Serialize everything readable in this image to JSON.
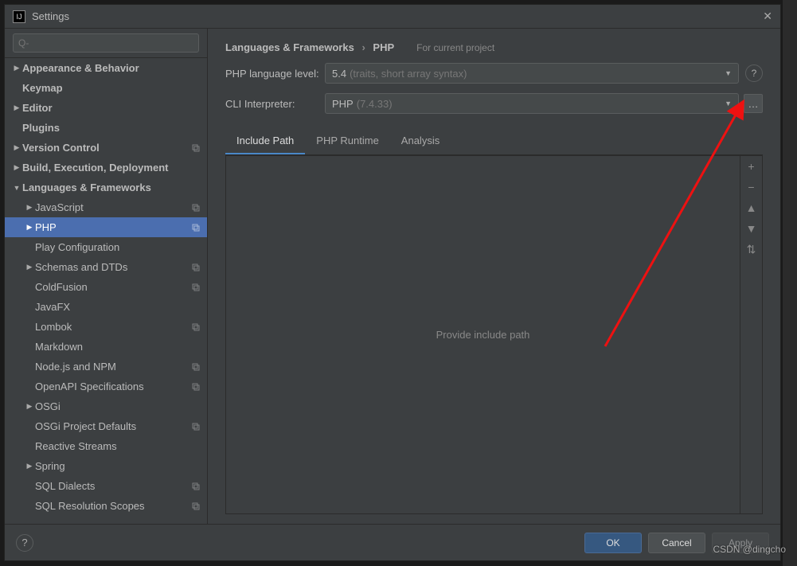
{
  "title": "Settings",
  "search_placeholder": "Q-",
  "breadcrumb": {
    "root": "Languages & Frameworks",
    "leaf": "PHP"
  },
  "header_hint": "For current project",
  "form": {
    "language_level_label": "PHP language level:",
    "language_level_value": "5.4",
    "language_level_hint": "(traits, short array syntax)",
    "cli_label": "CLI Interpreter:",
    "cli_value": "PHP",
    "cli_hint": "(7.4.33)"
  },
  "tabs": [
    "Include Path",
    "PHP Runtime",
    "Analysis"
  ],
  "active_tab": 0,
  "include_placeholder": "Provide include path",
  "sidebar": [
    {
      "label": "Appearance & Behavior",
      "level": 0,
      "arrow": "right",
      "bold": true
    },
    {
      "label": "Keymap",
      "level": 0,
      "bold": true
    },
    {
      "label": "Editor",
      "level": 0,
      "arrow": "right",
      "bold": true
    },
    {
      "label": "Plugins",
      "level": 0,
      "bold": true
    },
    {
      "label": "Version Control",
      "level": 0,
      "arrow": "right",
      "bold": true,
      "copy": true
    },
    {
      "label": "Build, Execution, Deployment",
      "level": 0,
      "arrow": "right",
      "bold": true
    },
    {
      "label": "Languages & Frameworks",
      "level": 0,
      "arrow": "down",
      "bold": true
    },
    {
      "label": "JavaScript",
      "level": 1,
      "arrow": "right",
      "copy": true
    },
    {
      "label": "PHP",
      "level": 1,
      "arrow": "right",
      "selected": true,
      "copy": true
    },
    {
      "label": "Play Configuration",
      "level": 1
    },
    {
      "label": "Schemas and DTDs",
      "level": 1,
      "arrow": "right",
      "copy": true
    },
    {
      "label": "ColdFusion",
      "level": 1,
      "copy": true
    },
    {
      "label": "JavaFX",
      "level": 1
    },
    {
      "label": "Lombok",
      "level": 1,
      "copy": true
    },
    {
      "label": "Markdown",
      "level": 1
    },
    {
      "label": "Node.js and NPM",
      "level": 1,
      "copy": true
    },
    {
      "label": "OpenAPI Specifications",
      "level": 1,
      "copy": true
    },
    {
      "label": "OSGi",
      "level": 1,
      "arrow": "right"
    },
    {
      "label": "OSGi Project Defaults",
      "level": 1,
      "copy": true
    },
    {
      "label": "Reactive Streams",
      "level": 1
    },
    {
      "label": "Spring",
      "level": 1,
      "arrow": "right"
    },
    {
      "label": "SQL Dialects",
      "level": 1,
      "copy": true
    },
    {
      "label": "SQL Resolution Scopes",
      "level": 1,
      "copy": true
    }
  ],
  "buttons": {
    "ok": "OK",
    "cancel": "Cancel",
    "apply": "Apply"
  },
  "watermark": "CSDN @dingcho"
}
